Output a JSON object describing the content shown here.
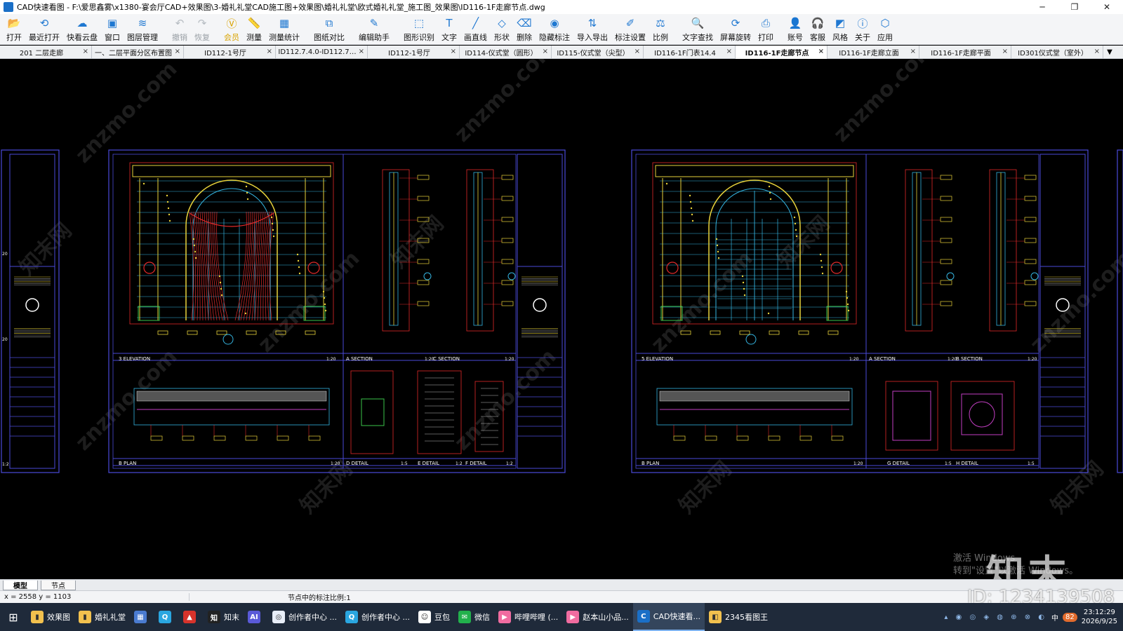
{
  "window": {
    "title": "CAD快速看图 - F:\\爱思鑫雾\\x1380-宴会厅CAD+效果图\\3-婚礼礼堂CAD施工图+效果图\\婚礼礼堂\\欧式婚礼礼堂_施工图_效果图\\ID116-1F走廊节点.dwg",
    "minimize": "─",
    "maximize": "❐",
    "close": "✕"
  },
  "toolbar": [
    {
      "label": "打开",
      "icon": "open-folder-icon",
      "glyph": "📂",
      "state": "normal"
    },
    {
      "label": "最近打开",
      "icon": "recent-icon",
      "glyph": "⟲",
      "state": "normal"
    },
    {
      "label": "快看云盘",
      "icon": "cloud-icon",
      "glyph": "☁",
      "state": "normal"
    },
    {
      "label": "窗口",
      "icon": "window-icon",
      "glyph": "▣",
      "state": "normal"
    },
    {
      "label": "图层管理",
      "icon": "layers-icon",
      "glyph": "≋",
      "state": "normal"
    },
    {
      "label": "撤销",
      "icon": "undo-icon",
      "glyph": "↶",
      "state": "disabled"
    },
    {
      "label": "恢复",
      "icon": "redo-icon",
      "glyph": "↷",
      "state": "disabled"
    },
    {
      "label": "会员",
      "icon": "vip-icon",
      "glyph": "Ⓥ",
      "state": "vip"
    },
    {
      "label": "测量",
      "icon": "ruler-icon",
      "glyph": "📏",
      "state": "normal"
    },
    {
      "label": "测量统计",
      "icon": "measure-stats-icon",
      "glyph": "▦",
      "state": "normal"
    },
    {
      "label": "图纸对比",
      "icon": "compare-icon",
      "glyph": "⧉",
      "state": "normal"
    },
    {
      "label": "编辑助手",
      "icon": "edit-assistant-icon",
      "glyph": "✎",
      "state": "normal"
    },
    {
      "label": "图形识别",
      "icon": "shape-recognize-icon",
      "glyph": "⬚",
      "state": "normal"
    },
    {
      "label": "文字",
      "icon": "text-icon",
      "glyph": "T",
      "state": "normal"
    },
    {
      "label": "画直线",
      "icon": "line-icon",
      "glyph": "╱",
      "state": "normal"
    },
    {
      "label": "形状",
      "icon": "shape-icon",
      "glyph": "◇",
      "state": "normal"
    },
    {
      "label": "删除",
      "icon": "eraser-icon",
      "glyph": "⌫",
      "state": "normal"
    },
    {
      "label": "隐藏标注",
      "icon": "hide-annotation-icon",
      "glyph": "◉",
      "state": "normal"
    },
    {
      "label": "导入导出",
      "icon": "import-export-icon",
      "glyph": "⇅",
      "state": "normal"
    },
    {
      "label": "标注设置",
      "icon": "annotation-settings-icon",
      "glyph": "✐",
      "state": "normal"
    },
    {
      "label": "比例",
      "icon": "scale-icon",
      "glyph": "⚖",
      "state": "normal"
    },
    {
      "label": "文字查找",
      "icon": "text-search-icon",
      "glyph": "🔍",
      "state": "normal"
    },
    {
      "label": "屏幕旋转",
      "icon": "rotate-screen-icon",
      "glyph": "⟳",
      "state": "normal"
    },
    {
      "label": "打印",
      "icon": "print-icon",
      "glyph": "⎙",
      "state": "normal"
    },
    {
      "label": "账号",
      "icon": "account-icon",
      "glyph": "👤",
      "state": "normal"
    },
    {
      "label": "客服",
      "icon": "headset-icon",
      "glyph": "🎧",
      "state": "normal"
    },
    {
      "label": "风格",
      "icon": "style-icon",
      "glyph": "◩",
      "state": "normal"
    },
    {
      "label": "关于",
      "icon": "info-icon",
      "glyph": "ⓘ",
      "state": "normal"
    },
    {
      "label": "应用",
      "icon": "apps-icon",
      "glyph": "⬡",
      "state": "normal"
    }
  ],
  "tabs": [
    {
      "label": "201 二层走廊",
      "active": false
    },
    {
      "label": "一、二层平面分区布置图",
      "active": false
    },
    {
      "label": "ID112-1号厅",
      "active": false
    },
    {
      "label": "ID112.7.4.0-ID112.7…",
      "active": false
    },
    {
      "label": "ID112-1号厅",
      "active": false
    },
    {
      "label": "ID114-仪式堂（圆形）",
      "active": false
    },
    {
      "label": "ID115-仪式堂（尖型）",
      "active": false
    },
    {
      "label": "ID116-1F门表14.4",
      "active": false
    },
    {
      "label": "ID116-1F走廊节点",
      "active": true
    },
    {
      "label": "ID116-1F走廊立面",
      "active": false
    },
    {
      "label": "ID116-1F走廊平面",
      "active": false
    },
    {
      "label": "ID301仪式堂（室外）",
      "active": false
    }
  ],
  "tab_close": "×",
  "tab_more": "▼",
  "drawing": {
    "sheet1": {
      "elevation_label": "3  ELEVATION",
      "elevation_scale": "1:20",
      "section_a": "A  SECTION",
      "section_a_scale": "1:20",
      "section_c": "C  SECTION",
      "section_c_scale": "1:20",
      "plan_label": "B  PLAN",
      "plan_scale": "1:20",
      "detail_d": "D  DETAIL",
      "detail_d_scale": "1:5",
      "detail_e": "E  DETAIL",
      "detail_e_scale": "1:2",
      "detail_f": "F  DETAIL",
      "detail_f_scale": "1:2"
    },
    "sheet2": {
      "elevation_label": "5  ELEVATION",
      "elevation_scale": "1:20",
      "section_a": "A  SECTION",
      "section_a_scale": "1:20",
      "section_b": "B  SECTION",
      "section_b_scale": "1:20",
      "plan_label": "B  PLAN",
      "plan_scale": "1:20",
      "detail_g": "G  DETAIL",
      "detail_g_scale": "1:5",
      "detail_h": "H  DETAIL",
      "detail_h_scale": "1:5"
    },
    "left_strip_labels": [
      "20",
      "20",
      "1:2"
    ],
    "watermark": "znzmo.com",
    "watermark_cn": "知末网"
  },
  "overlay": {
    "activate_line1": "激活 Windows",
    "activate_line2": "转到\"设置\"以激活 Windows。",
    "brand": "知末",
    "id_text": "ID: 1234139508"
  },
  "layout_tabs": [
    {
      "label": "模型",
      "active": true
    },
    {
      "label": "节点",
      "active": false
    }
  ],
  "status": {
    "coords": "x = 2558  y = 1103",
    "scale_text": "节点中的标注比例:1"
  },
  "taskbar": {
    "items": [
      {
        "label": "效果图",
        "color": "#f2c14e",
        "glyph": "▮",
        "active": false
      },
      {
        "label": "婚礼礼堂",
        "color": "#f2c14e",
        "glyph": "▮",
        "active": false
      },
      {
        "label": "",
        "color": "#4a7bd0",
        "glyph": "▦",
        "active": false
      },
      {
        "label": "",
        "color": "#2aa6e0",
        "glyph": "Q",
        "active": false
      },
      {
        "label": "",
        "color": "#d7332b",
        "glyph": "▲",
        "active": false
      },
      {
        "label": "知末",
        "color": "#222",
        "glyph": "知",
        "active": false
      },
      {
        "label": "",
        "color": "#5a5ad8",
        "glyph": "AI",
        "active": false
      },
      {
        "label": "创作者中心 ...",
        "color": "#e8eef8",
        "glyph": "◎",
        "active": false
      },
      {
        "label": "创作者中心 ...",
        "color": "#2aa6e0",
        "glyph": "Q",
        "active": false
      },
      {
        "label": "豆包",
        "color": "#ffffff",
        "glyph": "☺",
        "active": false
      },
      {
        "label": "微信",
        "color": "#22b14c",
        "glyph": "✉",
        "active": false
      },
      {
        "label": "哔哩哔哩 (...",
        "color": "#f06ca0",
        "glyph": "▶",
        "active": false
      },
      {
        "label": "赵本山小品...",
        "color": "#f06ca0",
        "glyph": "▶",
        "active": false
      },
      {
        "label": "CAD快速看...",
        "color": "#1a6fc7",
        "glyph": "C",
        "active": true
      },
      {
        "label": "2345看图王",
        "color": "#f2c14e",
        "glyph": "◧",
        "active": false
      }
    ],
    "tray_ime": "中",
    "tray_badge": "82",
    "time": "23:12:29",
    "date": "2026/9/25"
  }
}
